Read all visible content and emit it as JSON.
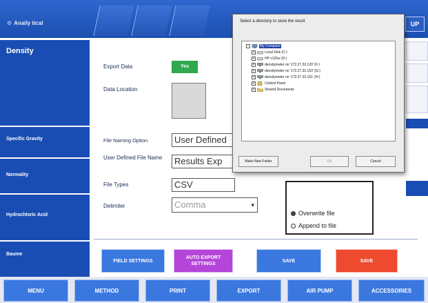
{
  "header": {
    "brand": "Anaily tical"
  },
  "sidebar": {
    "items": [
      {
        "label": "Density"
      },
      {
        "label": "Specific Gravity"
      },
      {
        "label": "Normality"
      },
      {
        "label": "Hydrochloric Acid"
      },
      {
        "label": "Baume"
      }
    ]
  },
  "form": {
    "export_data_label": "Export Data",
    "export_data_value": "Yes",
    "data_location_label": "Data Location",
    "file_naming_label": "File Naming Option",
    "file_naming_value": "User Defined",
    "user_defined_name_label": "User Defined File Name",
    "user_defined_name_value": "Results Exp",
    "file_types_label": "File Types",
    "file_types_value": "CSV",
    "delimiter_label": "Delimiter",
    "delimiter_value": "Comma",
    "write_mode": {
      "options": [
        "Overwrite file",
        "Append to file"
      ],
      "selected": "Overwrite file"
    }
  },
  "actions": {
    "field_settings": "FIELD SETTINGS",
    "auto_export_settings": "AUTO EXPORT SETTINGS",
    "save_blue": "SAVE",
    "save_red": "SAVE"
  },
  "bottom_nav": [
    "MENU",
    "METHOD",
    "PRINT",
    "EXPORT",
    "AIR PUMP",
    "ACCESSORIES"
  ],
  "dialog": {
    "title": "Select a directory to store the result",
    "tree": [
      {
        "label": "My Computer",
        "selected": true
      },
      {
        "label": "Local Disk (C:)"
      },
      {
        "label": "HP v125w (D:)"
      },
      {
        "label": "densitymeter on '172.27.32.120' (F:)"
      },
      {
        "label": "densitymeter on '172.27.32.153' (G:)"
      },
      {
        "label": "densitymeter on '172.27.32.151' (H:)"
      },
      {
        "label": "Control Panel"
      },
      {
        "label": "Shared Documents"
      }
    ],
    "make_new_folder": "Make New Folder",
    "ok": "OK",
    "cancel": "Cancel"
  },
  "colors": {
    "primary_blue": "#1a4db3",
    "button_blue": "#3a78e0",
    "purple": "#b445d8",
    "red": "#ee4a2f",
    "green": "#2fa84f"
  },
  "icons": [
    "gear-icon",
    "computer-icon",
    "drive-icon",
    "network-drive-icon",
    "control-panel-icon",
    "folder-icon",
    "chevron-down-icon"
  ]
}
